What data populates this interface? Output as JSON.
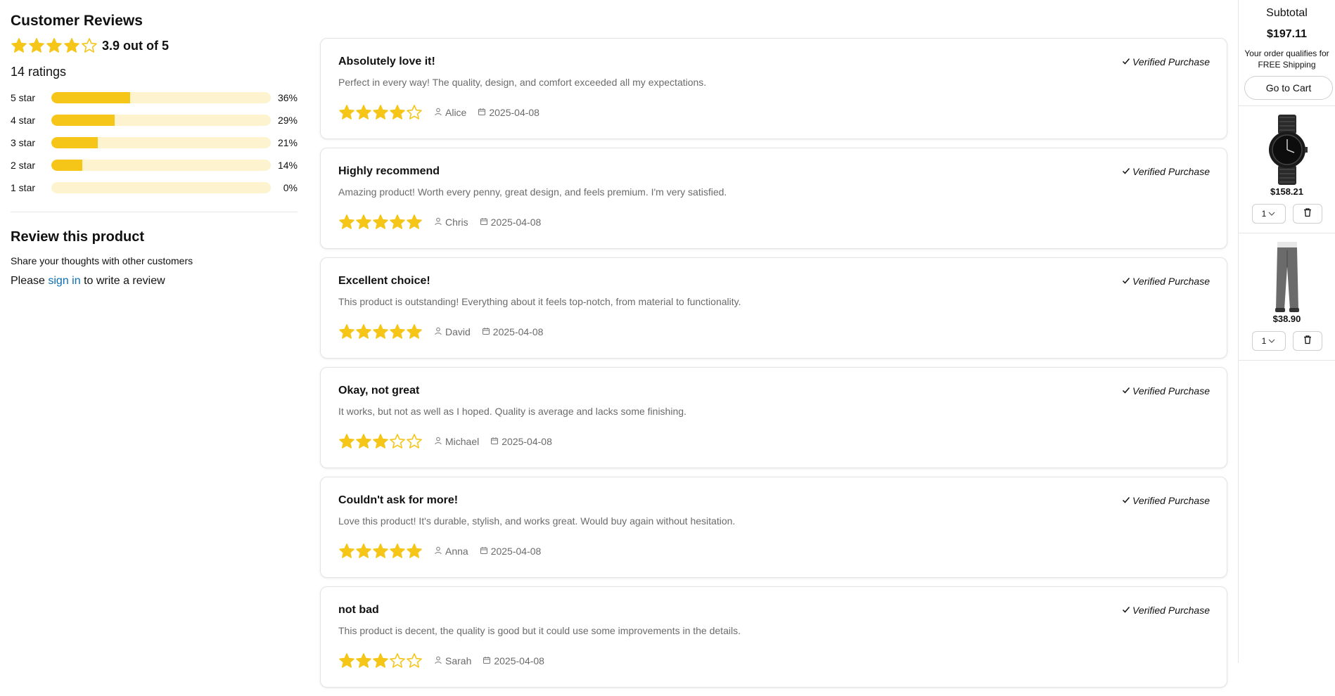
{
  "summary": {
    "title": "Customer Reviews",
    "average_text": "3.9 out of 5",
    "average_value": 3.9,
    "average_stars_filled": 4,
    "total_ratings": "14 ratings",
    "histogram": [
      {
        "label": "5 star",
        "pct_text": "36%",
        "pct": 36
      },
      {
        "label": "4 star",
        "pct_text": "29%",
        "pct": 29
      },
      {
        "label": "3 star",
        "pct_text": "21%",
        "pct": 21
      },
      {
        "label": "2 star",
        "pct_text": "14%",
        "pct": 14
      },
      {
        "label": "1 star",
        "pct_text": "0%",
        "pct": 0
      }
    ]
  },
  "write_review": {
    "title": "Review this product",
    "subtitle": "Share your thoughts with other customers",
    "prefix": "Please ",
    "link_text": "sign in",
    "suffix": " to write a review"
  },
  "reviews": [
    {
      "title": "Absolutely love it!",
      "body": "Perfect in every way! The quality, design, and comfort exceeded all my expectations.",
      "rating": 4,
      "author": "Alice",
      "date": "2025-04-08",
      "verified": "Verified Purchase"
    },
    {
      "title": "Highly recommend",
      "body": "Amazing product! Worth every penny, great design, and feels premium. I'm very satisfied.",
      "rating": 5,
      "author": "Chris",
      "date": "2025-04-08",
      "verified": "Verified Purchase"
    },
    {
      "title": "Excellent choice!",
      "body": "This product is outstanding! Everything about it feels top-notch, from material to functionality.",
      "rating": 5,
      "author": "David",
      "date": "2025-04-08",
      "verified": "Verified Purchase"
    },
    {
      "title": "Okay, not great",
      "body": "It works, but not as well as I hoped. Quality is average and lacks some finishing.",
      "rating": 3,
      "author": "Michael",
      "date": "2025-04-08",
      "verified": "Verified Purchase"
    },
    {
      "title": "Couldn't ask for more!",
      "body": "Love this product! It's durable, stylish, and works great. Would buy again without hesitation.",
      "rating": 5,
      "author": "Anna",
      "date": "2025-04-08",
      "verified": "Verified Purchase"
    },
    {
      "title": "not bad",
      "body": "This product is decent, the quality is good but it could use some improvements in the details.",
      "rating": 3,
      "author": "Sarah",
      "date": "2025-04-08",
      "verified": "Verified Purchase"
    }
  ],
  "cart": {
    "subtotal_label": "Subtotal",
    "subtotal_value": "$197.11",
    "shipping_note": "Your order qualifies for FREE Shipping",
    "go_to_cart": "Go to Cart",
    "items": [
      {
        "icon": "watch-icon",
        "price": "$158.21",
        "qty": "1"
      },
      {
        "icon": "jeans-icon",
        "price": "$38.90",
        "qty": "1"
      }
    ]
  },
  "colors": {
    "star": "#f5c518",
    "bar_bg": "#fdf3cf",
    "link": "#0a6eb4"
  }
}
